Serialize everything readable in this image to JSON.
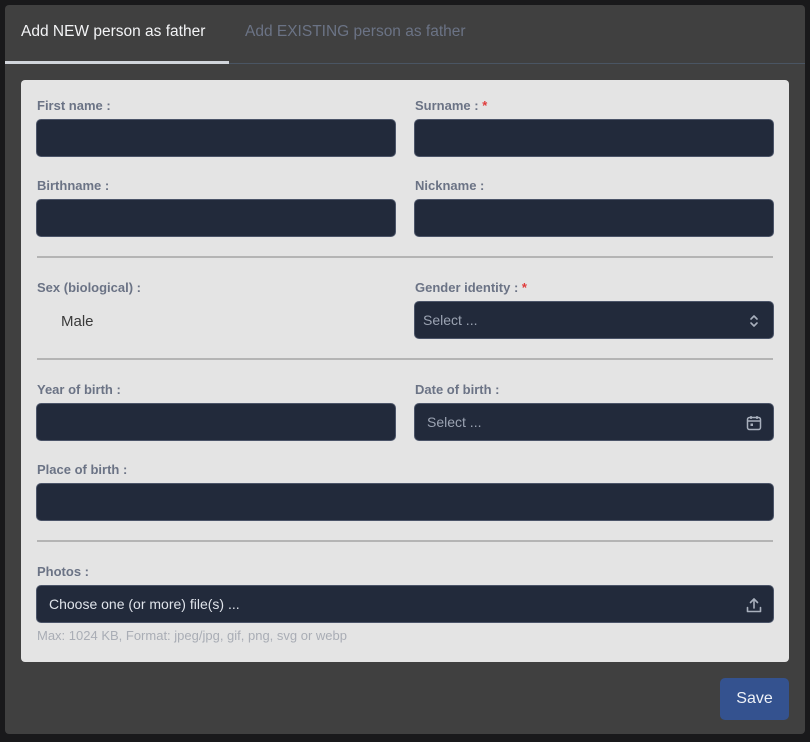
{
  "tabs": [
    {
      "label": "Add NEW person as father",
      "active": true
    },
    {
      "label": "Add EXISTING person as father",
      "active": false
    }
  ],
  "form": {
    "first_name": {
      "label": "First name :",
      "value": ""
    },
    "surname": {
      "label": "Surname :",
      "required_mark": "*",
      "value": ""
    },
    "birthname": {
      "label": "Birthname :",
      "value": ""
    },
    "nickname": {
      "label": "Nickname :",
      "value": ""
    },
    "sex": {
      "label": "Sex (biological) :",
      "value": "Male"
    },
    "gender_identity": {
      "label": "Gender identity :",
      "required_mark": "*",
      "placeholder": "Select ...",
      "icon": "chevron-up-down-icon"
    },
    "year_of_birth": {
      "label": "Year of birth :",
      "value": ""
    },
    "date_of_birth": {
      "label": "Date of birth :",
      "placeholder": "Select ...",
      "icon": "calendar-icon"
    },
    "place_of_birth": {
      "label": "Place of birth :",
      "value": ""
    },
    "photos": {
      "label": "Photos :",
      "placeholder": "Choose one (or more) file(s) ...",
      "icon": "upload-icon",
      "hint": "Max: 1024 KB, Format: jpeg/jpg, gif, png, svg or webp"
    }
  },
  "actions": {
    "save_label": "Save"
  },
  "colors": {
    "accent": "#34528f",
    "required": "#e03b3b",
    "input_bg": "#222a3b",
    "card_bg": "#e4e4e4",
    "modal_bg": "#404040"
  }
}
